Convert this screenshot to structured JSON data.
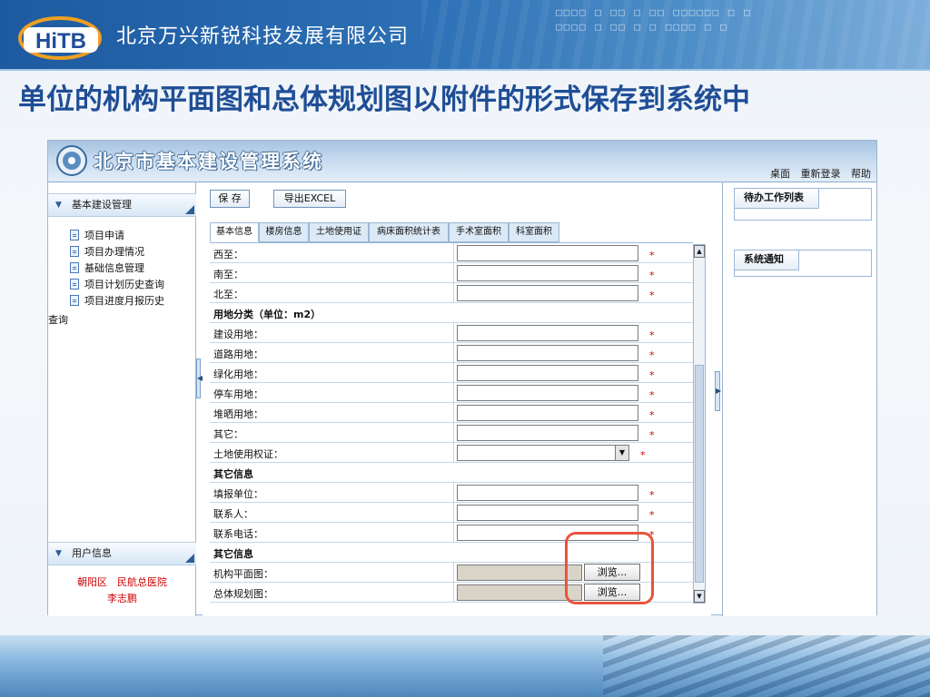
{
  "company": "北京万兴新锐科技发展有限公司",
  "logo_text": "HiTB",
  "slide_title": "单位的机构平面图和总体规划图以附件的形式保存到系统中",
  "app": {
    "title": "北京市基本建设管理系统",
    "top_links": [
      "桌面",
      "重新登录",
      "帮助"
    ]
  },
  "sidebar": {
    "section1": "基本建设管理",
    "items": [
      "项目申请",
      "项目办理情况",
      "基础信息管理",
      "项目计划历史查询",
      "项目进度月报历史"
    ],
    "overflow_text": "查询",
    "section2": "用户信息",
    "user_line1": "朝阳区　民航总医院",
    "user_line2": "李志鹏"
  },
  "toolbar": {
    "save": "保 存",
    "export": "导出EXCEL"
  },
  "tabs": [
    "基本信息",
    "楼房信息",
    "土地使用证",
    "病床面积统计表",
    "手术室面积",
    "科室面积"
  ],
  "form": {
    "rows": [
      {
        "label": "西至：",
        "type": "input",
        "required": "*"
      },
      {
        "label": "南至：",
        "type": "input",
        "required": "*"
      },
      {
        "label": "北至：",
        "type": "input",
        "required": "*"
      },
      {
        "label": "用地分类（单位：m2）",
        "type": "header"
      },
      {
        "label": "建设用地：",
        "type": "input",
        "required": "*"
      },
      {
        "label": "道路用地：",
        "type": "input",
        "required": "*"
      },
      {
        "label": "绿化用地：",
        "type": "input",
        "required": "*"
      },
      {
        "label": "停车用地：",
        "type": "input",
        "required": "*"
      },
      {
        "label": "堆晒用地：",
        "type": "input",
        "required": "*"
      },
      {
        "label": "其它：",
        "type": "input",
        "required": "*"
      },
      {
        "label": "土地使用权证：",
        "type": "select",
        "required": "*"
      },
      {
        "label": "其它信息",
        "type": "header"
      },
      {
        "label": "填报单位：",
        "type": "input",
        "required": "*"
      },
      {
        "label": "联系人：",
        "type": "input",
        "required": "*"
      },
      {
        "label": "联系电话：",
        "type": "input",
        "required": "*"
      },
      {
        "label": "其它信息",
        "type": "header"
      },
      {
        "label": "机构平面图：",
        "type": "file",
        "button": "浏览..."
      },
      {
        "label": "总体规划图：",
        "type": "file",
        "button": "浏览..."
      }
    ]
  },
  "right_panel": {
    "todo": "待办工作列表",
    "notice": "系统通知"
  },
  "colors": {
    "accent": "#1f4e96",
    "required": "#d00000",
    "highlight": "#e9543c"
  }
}
